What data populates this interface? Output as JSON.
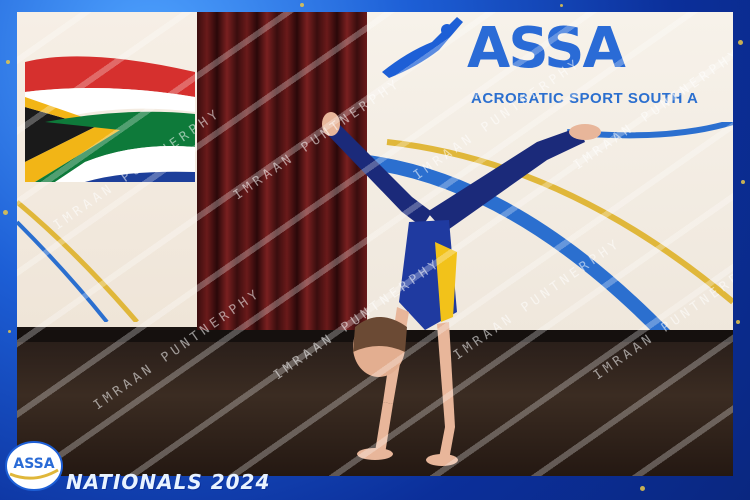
{
  "photo": {
    "banner_logo": "ASSA",
    "banner_org": "ACROBATIC SPORT SOUTH A",
    "badge_text": "ASSA",
    "event_title": "NATIONALS 2024"
  },
  "watermark": {
    "text": "IMRAAN PUNTNERPHY"
  },
  "colors": {
    "frame_blue": "#1d5fd6",
    "gold": "#e7c74a",
    "costume_blue": "#1b2a7a"
  },
  "icons": [
    "south-africa-flag-icon",
    "assa-badge-icon"
  ]
}
